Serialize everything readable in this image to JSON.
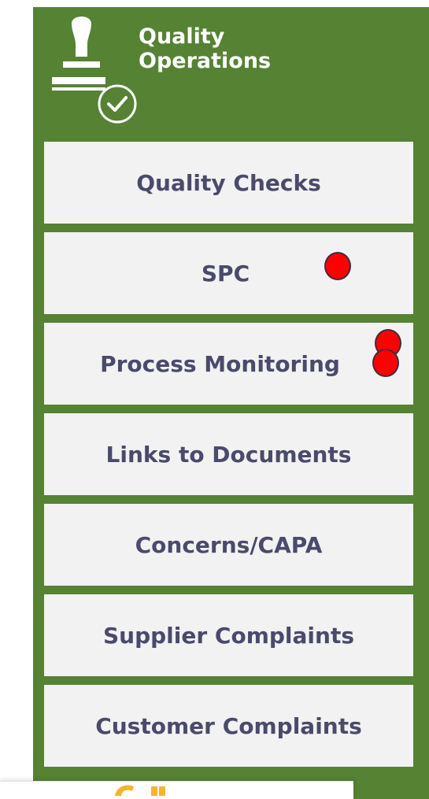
{
  "header": {
    "title_line1": "Quality",
    "title_line2": "Operations",
    "icon": "stamp-check-icon"
  },
  "nav": {
    "quality_checks": "Quality Checks",
    "spc": "SPC",
    "process_monitoring": "Process Monitoring",
    "links_to_documents": "Links to Documents",
    "concerns_capa": "Concerns/CAPA",
    "supplier_complaints": "Supplier Complaints",
    "customer_complaints": "Customer Complaints"
  },
  "colors": {
    "panel": "#568234",
    "button": "#f2f2f2",
    "label": "#4a4a6c",
    "marker": "#ff0000",
    "marker_border": "#402a40",
    "accent_bottom": "#f2b52c"
  }
}
